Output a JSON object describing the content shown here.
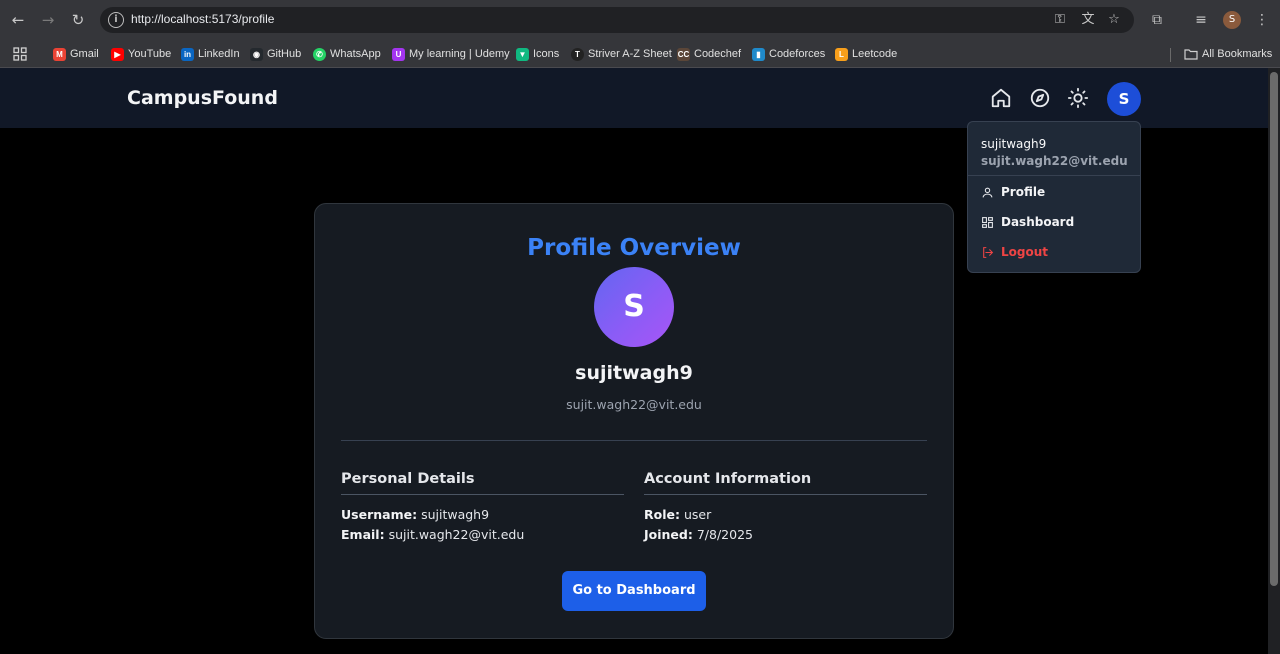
{
  "browser": {
    "url": "http://localhost:5173/profile",
    "profile_initial": "S",
    "bookmarks": [
      {
        "label": "Gmail",
        "color": "#ea4335",
        "glyph": "M"
      },
      {
        "label": "YouTube",
        "color": "#ff0000",
        "glyph": "▶"
      },
      {
        "label": "LinkedIn",
        "color": "#0a66c2",
        "glyph": "in"
      },
      {
        "label": "GitHub",
        "color": "#24292e",
        "glyph": "◉"
      },
      {
        "label": "WhatsApp",
        "color": "#25d366",
        "glyph": "✆"
      },
      {
        "label": "My learning | Udemy",
        "color": "#a435f0",
        "glyph": "U"
      },
      {
        "label": "Icons",
        "color": "#10b981",
        "glyph": "▼"
      },
      {
        "label": "Striver A-Z Sheet",
        "color": "#222222",
        "glyph": "T"
      },
      {
        "label": "Codechef",
        "color": "#5b4638",
        "glyph": "CC"
      },
      {
        "label": "Codeforces",
        "color": "#1f8acb",
        "glyph": "▮"
      },
      {
        "label": "Leetcode",
        "color": "#f89f1b",
        "glyph": "L"
      }
    ],
    "all_bookmarks": "All Bookmarks"
  },
  "navbar": {
    "brand": "CampusFound",
    "user_initial": "S"
  },
  "dropdown": {
    "username": "sujitwagh9",
    "email": "sujit.wagh22@vit.edu",
    "profile_label": "Profile",
    "dashboard_label": "Dashboard",
    "logout_label": "Logout"
  },
  "profile": {
    "title": "Profile Overview",
    "initial": "S",
    "username": "sujitwagh9",
    "email": "sujit.wagh22@vit.edu",
    "personal": {
      "heading": "Personal Details",
      "username_label": "Username:",
      "username_value": "sujitwagh9",
      "email_label": "Email:",
      "email_value": "sujit.wagh22@vit.edu"
    },
    "account": {
      "heading": "Account Information",
      "role_label": "Role:",
      "role_value": "user",
      "joined_label": "Joined:",
      "joined_value": "7/8/2025"
    },
    "dashboard_button": "Go to Dashboard"
  },
  "colors": {
    "accent": "#3b82f6",
    "button": "#1d5fe8",
    "logout": "#ef4444",
    "navbar": "#111827",
    "card": "#161b22"
  }
}
